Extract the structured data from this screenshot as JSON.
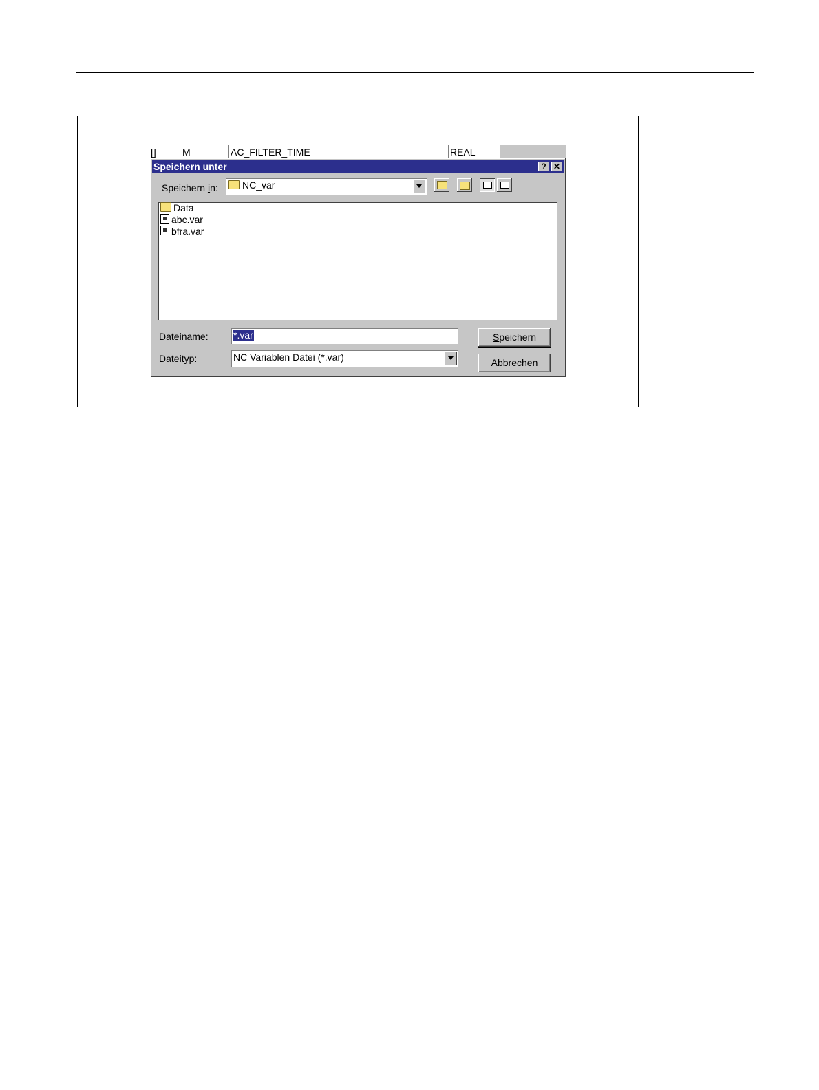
{
  "background_table": {
    "col1": "[]",
    "col2": "M",
    "col3": "AC_FILTER_TIME",
    "col4": "REAL"
  },
  "dialog": {
    "title": "Speichern unter",
    "help_button": "?",
    "close_button": "✕",
    "save_in_label": "Speichern in:",
    "save_in_value": "NC_var",
    "files": [
      {
        "name": "Data",
        "icon": "folder-icon"
      },
      {
        "name": "abc.var",
        "icon": "file-icon"
      },
      {
        "name": "bfra.var",
        "icon": "file-icon"
      }
    ],
    "filename_label": "Dateiname:",
    "filename_value": "*.var",
    "filetype_label": "Dateityp:",
    "filetype_value": "NC Variablen Datei (*.var)",
    "save_button": "Speichern",
    "cancel_button": "Abbrechen"
  },
  "colors": {
    "titlebar": "#2c2f8d",
    "dialog_face": "#c6c6c6"
  }
}
